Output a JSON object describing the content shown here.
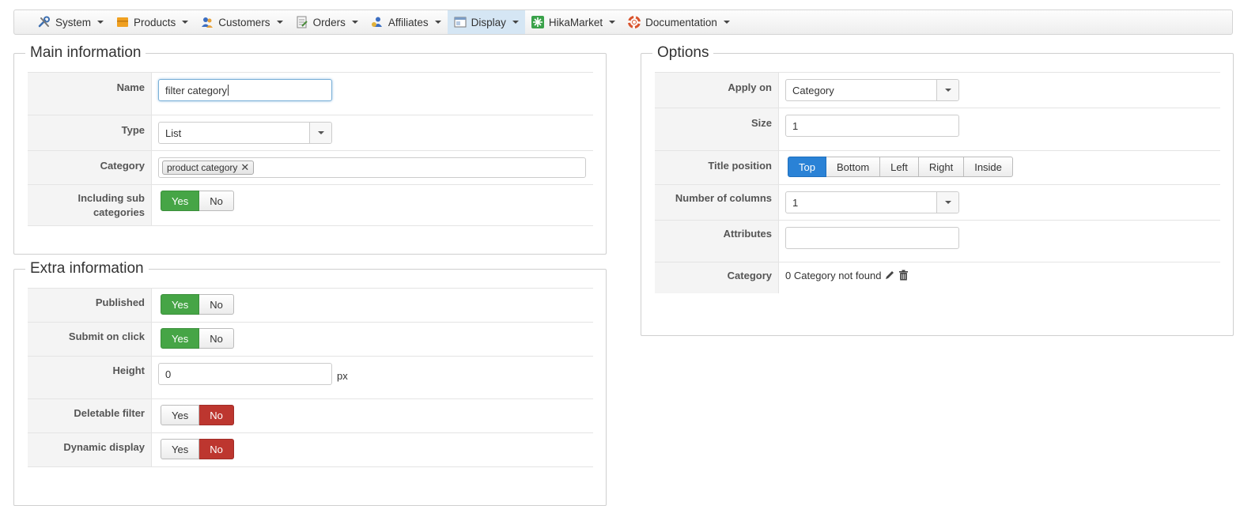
{
  "menu": [
    {
      "label": "System",
      "icon": "tools-icon",
      "active": false
    },
    {
      "label": "Products",
      "icon": "products-box-icon",
      "active": false
    },
    {
      "label": "Customers",
      "icon": "customers-icon",
      "active": false
    },
    {
      "label": "Orders",
      "icon": "orders-icon",
      "active": false
    },
    {
      "label": "Affiliates",
      "icon": "affiliates-icon",
      "active": false
    },
    {
      "label": "Display",
      "icon": "display-icon",
      "active": true
    },
    {
      "label": "HikaMarket",
      "icon": "hikamarket-icon",
      "active": false
    },
    {
      "label": "Documentation",
      "icon": "lifebuoy-icon",
      "active": false
    }
  ],
  "main": {
    "title": "Main information",
    "name_label": "Name",
    "name_value": "filter category",
    "type_label": "Type",
    "type_value": "List",
    "category_label": "Category",
    "category_tag": "product category",
    "category_tag_remove": "✕",
    "subcat_label": "Including sub categories",
    "subcat_yes": "Yes",
    "subcat_no": "No"
  },
  "extra": {
    "title": "Extra information",
    "published_label": "Published",
    "published_yes": "Yes",
    "published_no": "No",
    "submit_label": "Submit on click",
    "submit_yes": "Yes",
    "submit_no": "No",
    "height_label": "Height",
    "height_value": "0",
    "height_unit": "px",
    "deletable_label": "Deletable filter",
    "deletable_yes": "Yes",
    "deletable_no": "No",
    "dynamic_label": "Dynamic display",
    "dynamic_yes": "Yes",
    "dynamic_no": "No"
  },
  "options": {
    "title": "Options",
    "apply_label": "Apply on",
    "apply_value": "Category",
    "size_label": "Size",
    "size_value": "1",
    "title_pos_label": "Title position",
    "title_pos_buttons": [
      "Top",
      "Bottom",
      "Left",
      "Right",
      "Inside"
    ],
    "columns_label": "Number of columns",
    "columns_value": "1",
    "attributes_label": "Attributes",
    "attributes_value": "",
    "category_label": "Category",
    "category_text": "0 Category not found"
  },
  "colors": {
    "active_green": "#46a546",
    "active_red": "#bd362f",
    "active_blue": "#2a82d6",
    "menu_active_bg": "#d5e6f4"
  }
}
